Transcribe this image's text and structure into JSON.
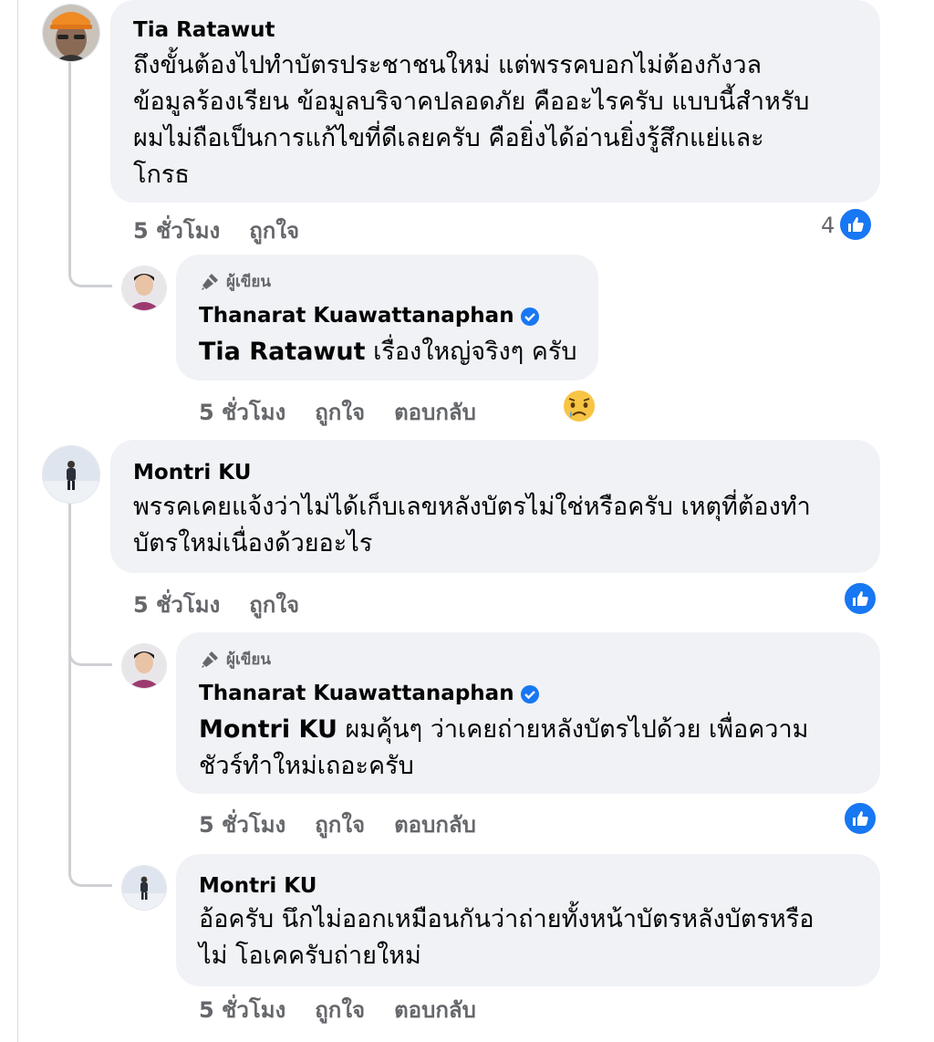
{
  "comments": [
    {
      "author": "Tia Ratawut",
      "lines": [
        "ถึงขั้นต้องไปทำบัตรประชาชนใหม่ แต่พรรคบอกไม่ต้องกังวล",
        "ข้อมูลร้องเรียน ข้อมูลบริจาคปลอดภัย คืออะไรครับ แบบนี้สำหรับ",
        "ผมไม่ถือเป็นการแก้ไขที่ดีเลยครับ คือยิ่งได้อ่านยิ่งรู้สึกแย่และ",
        "โกรธ"
      ],
      "time": "5 ชั่วโมง",
      "like": "ถูกใจ",
      "reaction_count": "4",
      "reaction": "like-icon"
    },
    {
      "author_tag": "ผู้เขียน",
      "author": "Thanarat Kuawattanaphan",
      "mention": "Tia Ratawut",
      "text": " เรื่องใหญ่จริงๆ ครับ",
      "time": "5 ชั่วโมง",
      "like": "ถูกใจ",
      "reply": "ตอบกลับ",
      "reaction": "sad-emoji"
    },
    {
      "author": "Montri KU",
      "lines": [
        "พรรคเคยแจ้งว่าไม่ได้เก็บเลขหลังบัตรไม่ใช่หรือครับ เหตุที่ต้องทำ",
        "บัตรใหม่เนื่องด้วยอะไร"
      ],
      "time": "5 ชั่วโมง",
      "like": "ถูกใจ",
      "reaction": "like-icon"
    },
    {
      "author_tag": "ผู้เขียน",
      "author": "Thanarat Kuawattanaphan",
      "mention": "Montri KU",
      "text_line1": " ผมคุ้นๆ ว่าเคยถ่ายหลังบัตรไปด้วย เพื่อความ",
      "text_line2": "ชัวร์ทำใหม่เถอะครับ",
      "time": "5 ชั่วโมง",
      "like": "ถูกใจ",
      "reply": "ตอบกลับ",
      "reaction": "like-icon"
    },
    {
      "author": "Montri KU",
      "lines": [
        "อ้อครับ นึกไม่ออกเหมือนกันว่าถ่ายทั้งหน้าบัตรหลังบัตรหรือ",
        "ไม่ โอเคครับถ่ายใหม่"
      ],
      "time": "5 ชั่วโมง",
      "like": "ถูกใจ",
      "reply": "ตอบกลับ"
    }
  ],
  "colors": {
    "bubble": "#f0f2f5",
    "meta": "#65676b",
    "accent": "#1877f2",
    "line": "#ced0d4"
  }
}
